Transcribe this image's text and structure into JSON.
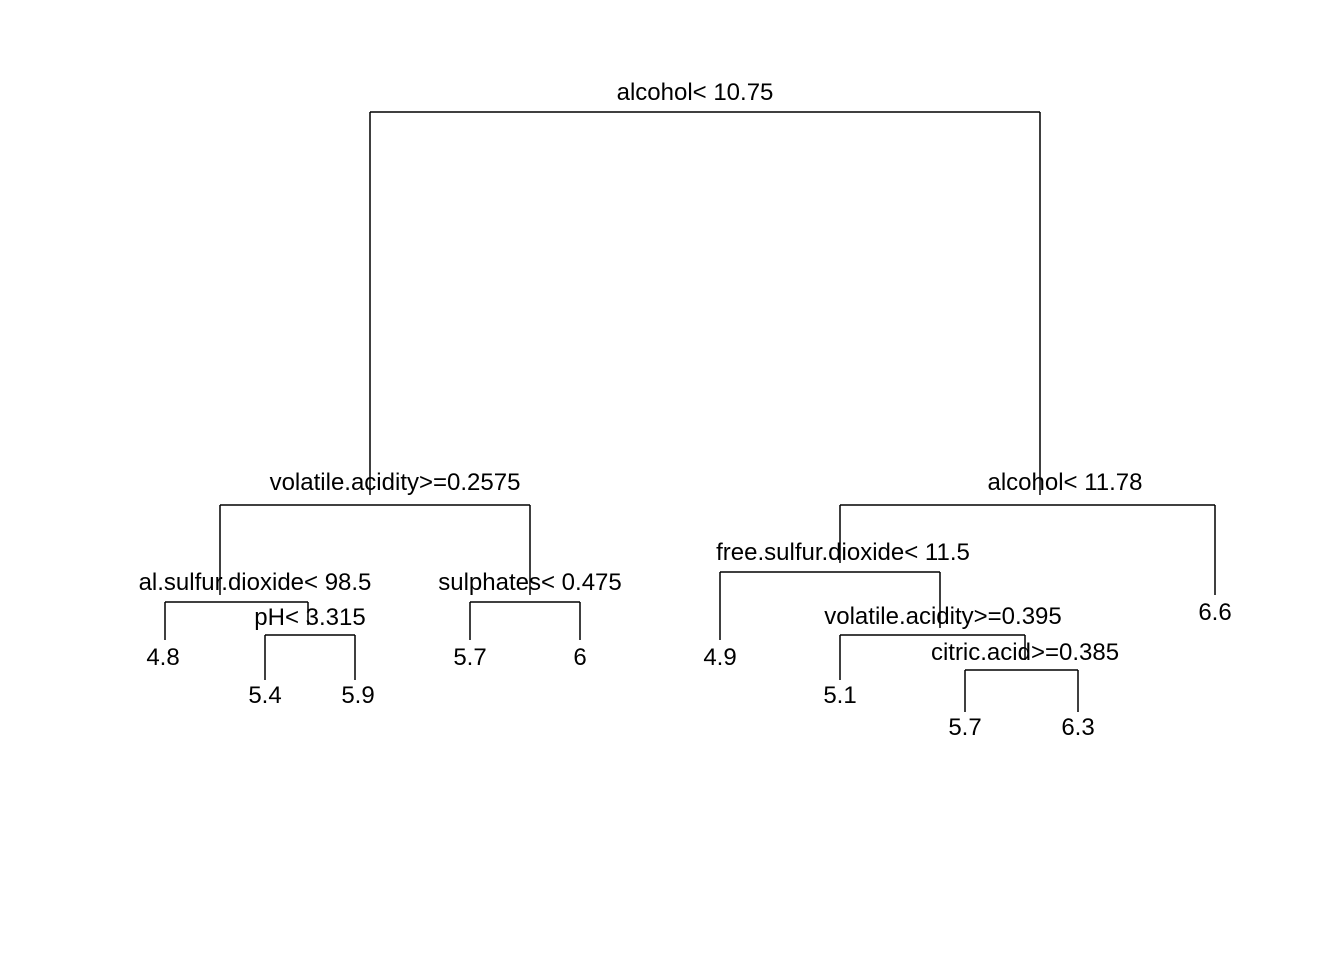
{
  "tree": {
    "root_label": "alcohol< 10.75",
    "left": {
      "label": "volatile.acidity>=0.2575",
      "left": {
        "label": "al.sulfur.dioxide< 98.5",
        "left_leaf": "4.8",
        "right": {
          "label": "pH< 3.315",
          "left_leaf": "5.4",
          "right_leaf": "5.9"
        }
      },
      "right": {
        "label": "sulphates< 0.475",
        "left_leaf": "5.7",
        "right_leaf": "6"
      }
    },
    "right": {
      "label": "alcohol< 11.78",
      "left": {
        "label": "free.sulfur.dioxide< 11.5",
        "left_leaf": "4.9",
        "right": {
          "label": "volatile.acidity>=0.395",
          "left_leaf": "5.1",
          "right": {
            "label": "citric.acid>=0.385",
            "left_leaf": "5.7",
            "right_leaf": "6.3"
          }
        }
      },
      "right_leaf": "6.6"
    }
  }
}
